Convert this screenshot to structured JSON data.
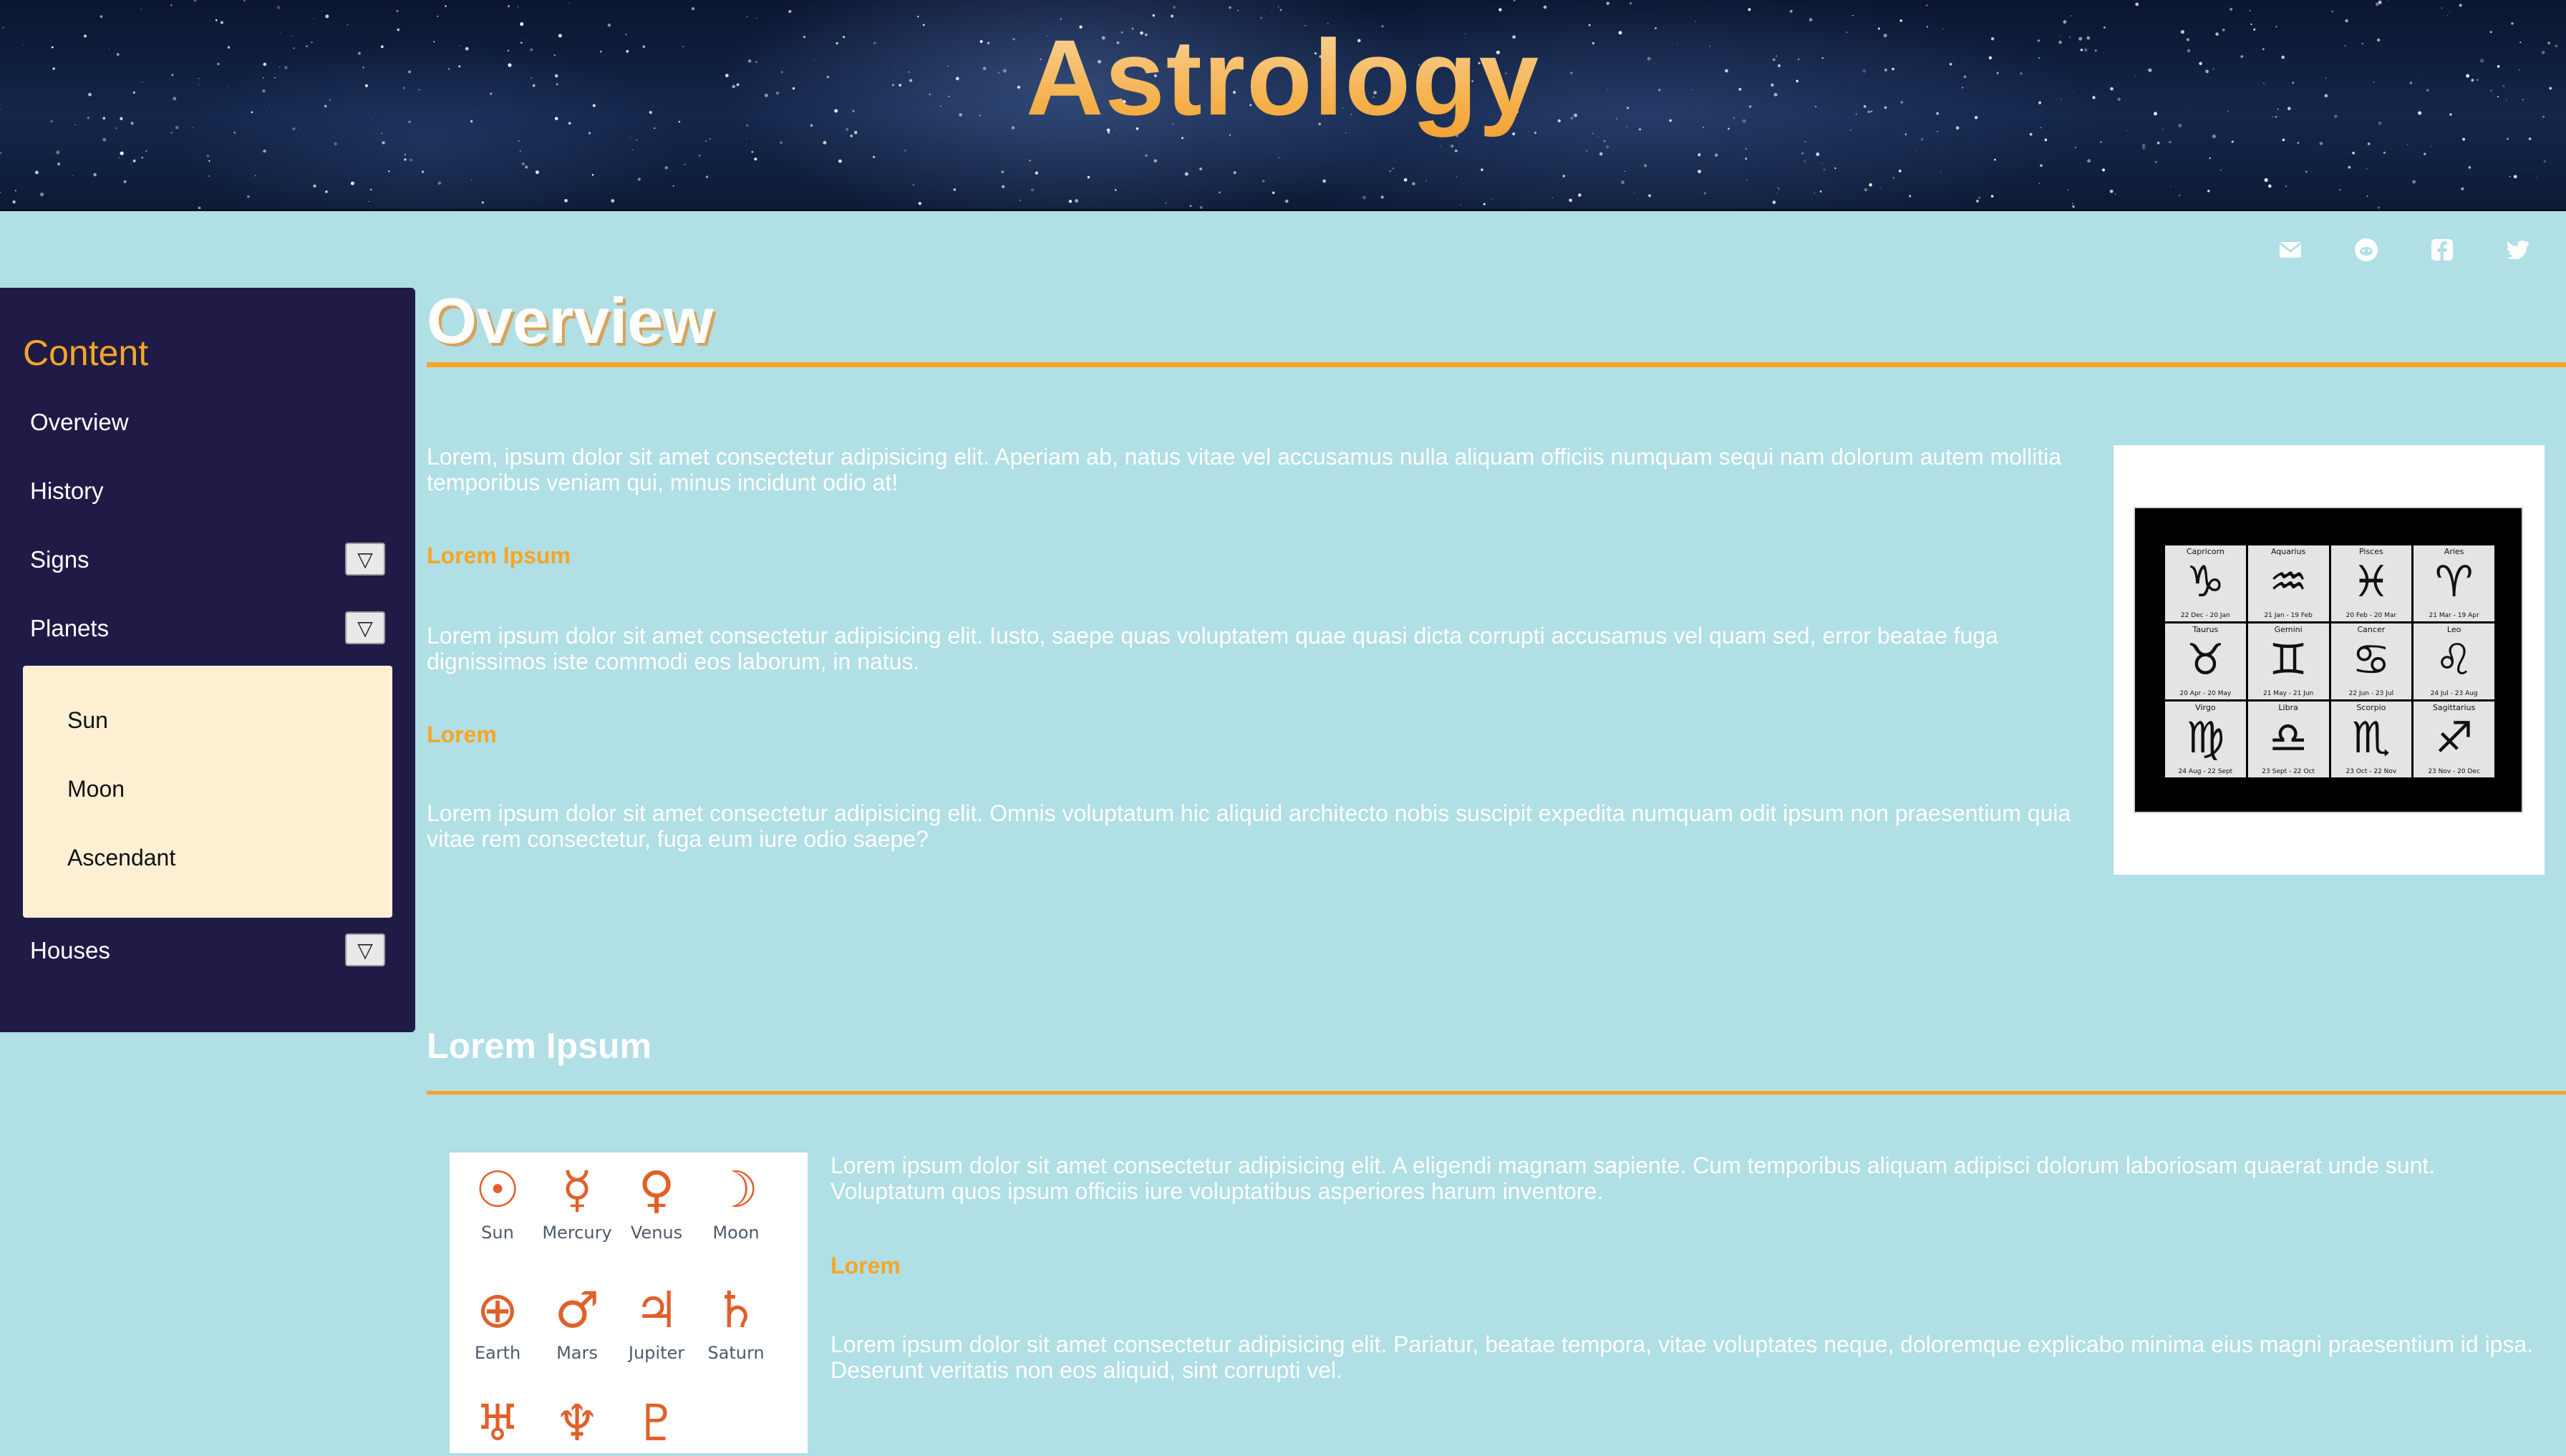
{
  "site": {
    "title": "Astrology"
  },
  "social": [
    "envelope-icon",
    "reddit-icon",
    "facebook-icon",
    "twitter-icon"
  ],
  "sidebar": {
    "title": "Content",
    "items": [
      {
        "label": "Overview"
      },
      {
        "label": "History"
      },
      {
        "label": "Signs",
        "dropdown": "▽"
      },
      {
        "label": "Planets",
        "dropdown": "▽"
      },
      {
        "label": "Houses",
        "dropdown": "▽"
      }
    ],
    "planets_submenu": [
      "Sun",
      "Moon",
      "Ascendant"
    ]
  },
  "overview": {
    "heading": "Overview",
    "p1": "Lorem, ipsum dolor sit amet consectetur adipisicing elit. Aperiam ab, natus vitae vel accusamus nulla aliquam officiis numquam sequi nam dolorum autem mollitia temporibus veniam qui, minus incidunt odio at!",
    "sub1": "Lorem Ipsum",
    "p2": "Lorem ipsum dolor sit amet consectetur adipisicing elit. Iusto, saepe quas voluptatem quae quasi dicta corrupti accusamus vel quam sed, error beatae fuga dignissimos iste commodi eos laborum, in natus.",
    "sub2": "Lorem",
    "p3": "Lorem ipsum dolor sit amet consectetur adipisicing elit. Omnis voluptatum hic aliquid architecto nobis suscipit expedita numquam odit ipsum non praesentium quia vitae rem consectetur, fuga eum iure odio saepe?"
  },
  "zodiac": [
    {
      "name": "Capricorn",
      "symbol": "♑",
      "dates": "22 Dec - 20 Jan"
    },
    {
      "name": "Aquarius",
      "symbol": "♒",
      "dates": "21 Jan - 19 Feb"
    },
    {
      "name": "Pisces",
      "symbol": "♓",
      "dates": "20 Feb - 20 Mar"
    },
    {
      "name": "Aries",
      "symbol": "♈",
      "dates": "21 Mar - 19 Apr"
    },
    {
      "name": "Taurus",
      "symbol": "♉",
      "dates": "20 Apr - 20 May"
    },
    {
      "name": "Gemini",
      "symbol": "♊",
      "dates": "21 May - 21 Jun"
    },
    {
      "name": "Cancer",
      "symbol": "♋",
      "dates": "22 Jun - 23 Jul"
    },
    {
      "name": "Leo",
      "symbol": "♌",
      "dates": "24 Jul - 23 Aug"
    },
    {
      "name": "Virgo",
      "symbol": "♍",
      "dates": "24 Aug - 22 Sept"
    },
    {
      "name": "Libra",
      "symbol": "♎",
      "dates": "23 Sept - 22 Oct"
    },
    {
      "name": "Scorpio",
      "symbol": "♏",
      "dates": "23 Oct - 22 Nov"
    },
    {
      "name": "Sagittarius",
      "symbol": "♐",
      "dates": "23 Nov - 20 Dec"
    }
  ],
  "section2": {
    "heading": "Lorem Ipsum",
    "p1": "Lorem ipsum dolor sit amet consectetur adipisicing elit. A eligendi magnam sapiente. Cum temporibus aliquam adipisci dolorum laboriosam quaerat unde sunt. Voluptatum quos ipsum officiis iure voluptatibus asperiores harum inventore.",
    "sub1": "Lorem",
    "p2": "Lorem ipsum dolor sit amet consectetur adipisicing elit. Pariatur, beatae tempora, vitae voluptates neque, doloremque explicabo minima eius magni praesentium id ipsa. Deserunt veritatis non eos aliquid, sint corrupti vel."
  },
  "planets": [
    {
      "symbol": "☉",
      "label": "Sun"
    },
    {
      "symbol": "☿",
      "label": "Mercury"
    },
    {
      "symbol": "♀",
      "label": "Venus"
    },
    {
      "symbol": "☽",
      "label": "Moon"
    },
    {
      "symbol": "⊕",
      "label": "Earth"
    },
    {
      "symbol": "♂",
      "label": "Mars"
    },
    {
      "symbol": "♃",
      "label": "Jupiter"
    },
    {
      "symbol": "♄",
      "label": "Saturn"
    },
    {
      "symbol": "♅",
      "label": ""
    },
    {
      "symbol": "♆",
      "label": ""
    },
    {
      "symbol": "♇",
      "label": ""
    }
  ],
  "colors": {
    "background": "#b0dfe5",
    "sidebar": "#1f1b46",
    "accent": "#f6a623",
    "submenu": "#fff0d4"
  }
}
